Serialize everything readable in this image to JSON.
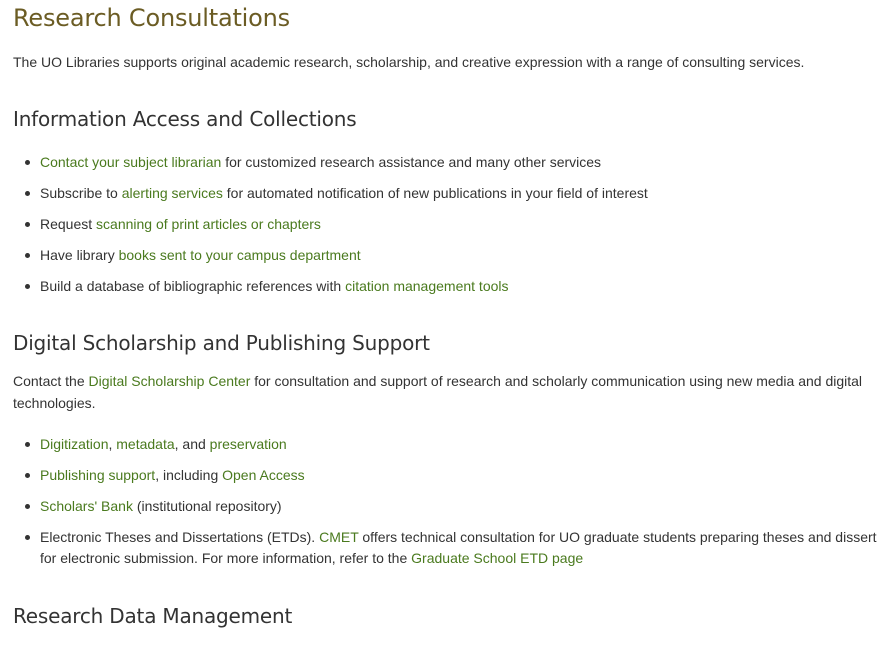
{
  "title": "Research Consultations",
  "intro": "The UO Libraries supports original academic research, scholarship, and creative expression with a range of consulting services.",
  "sections": {
    "info_access": {
      "heading": "Information Access and Collections",
      "items": [
        {
          "link": "Contact your subject librarian",
          "after": " for customized research assistance and many other services"
        },
        {
          "before": "Subscribe to ",
          "link": "alerting services",
          "after": " for automated notification of new publications in your field of interest"
        },
        {
          "before": "Request ",
          "link": "scanning of print articles or chapters"
        },
        {
          "before": "Have library ",
          "link": "books sent to your campus department"
        },
        {
          "before": "Build a database of bibliographic references with ",
          "link": "citation management tools"
        }
      ]
    },
    "digital": {
      "heading": "Digital Scholarship and Publishing Support",
      "para_before": "Contact the ",
      "para_link": "Digital Scholarship Center",
      "para_after_line1": " for consultation and support of research and scholarly communication using new media and digital",
      "para_line2": "technologies.",
      "items": {
        "digitization": {
          "link1": "Digitization",
          "sep1": ", ",
          "link2": "metadata",
          "sep2": ", and ",
          "link3": "preservation"
        },
        "publishing": {
          "link1": "Publishing support",
          "mid": ", including ",
          "link2": "Open Access"
        },
        "scholars": {
          "link": "Scholars' Bank",
          "after": " (institutional repository)"
        },
        "etd": {
          "before": "Electronic Theses and Dissertations (ETDs). ",
          "link1": "CMET",
          "after_line1": " offers technical consultation for UO graduate students preparing theses and dissertations",
          "line2_before": "for electronic submission. For more information, refer to the ",
          "link2": "Graduate School ETD page"
        }
      }
    },
    "research_data": {
      "heading": "Research Data Management"
    }
  },
  "colors": {
    "title": "#6b5c24",
    "link": "#4a7a1e",
    "text": "#333333"
  }
}
